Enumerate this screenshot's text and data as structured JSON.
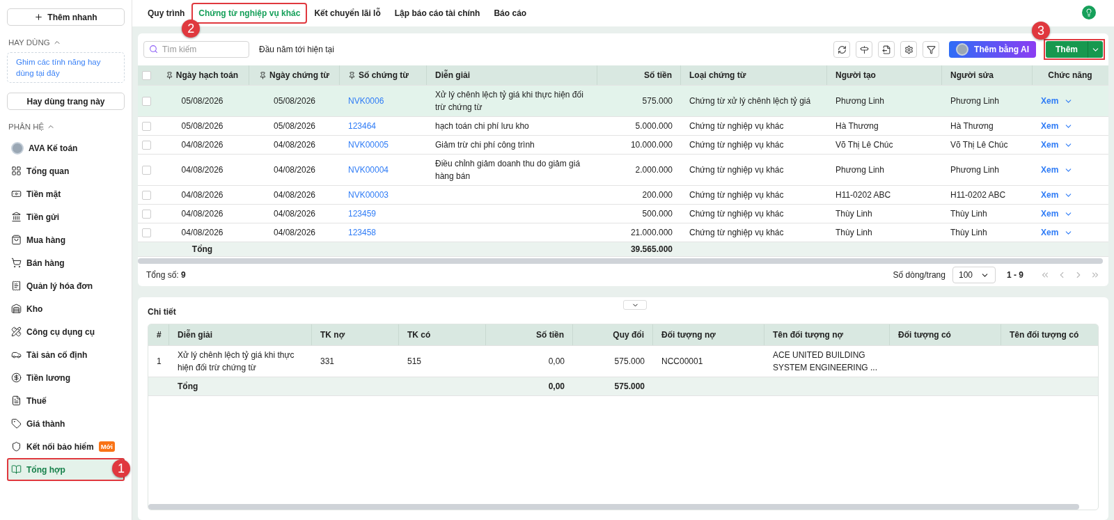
{
  "sidebar": {
    "quick_add": "Thêm nhanh",
    "favorites": {
      "title": "HAY DÙNG",
      "expanded": true,
      "hint": "Ghim các tính năng hay dùng tại đây",
      "button": "Hay dùng trang này"
    },
    "modules": {
      "title": "PHÂN HỆ",
      "expanded": true,
      "items": [
        {
          "label": "AVA Kế toán",
          "kind": "avatar",
          "selected": false
        },
        {
          "label": "Tổng quan",
          "kind": "module",
          "selected": false
        },
        {
          "label": "Tiền mặt",
          "kind": "module",
          "selected": false
        },
        {
          "label": "Tiền gửi",
          "kind": "module",
          "selected": false
        },
        {
          "label": "Mua hàng",
          "kind": "module",
          "selected": false
        },
        {
          "label": "Bán hàng",
          "kind": "module",
          "selected": false
        },
        {
          "label": "Quản lý hóa đơn",
          "kind": "module",
          "selected": false
        },
        {
          "label": "Kho",
          "kind": "module",
          "selected": false
        },
        {
          "label": "Công cụ dụng cụ",
          "kind": "module",
          "selected": false
        },
        {
          "label": "Tài sản cố định",
          "kind": "module",
          "selected": false
        },
        {
          "label": "Tiền lương",
          "kind": "module",
          "selected": false
        },
        {
          "label": "Thuế",
          "kind": "module",
          "selected": false
        },
        {
          "label": "Giá thành",
          "kind": "module",
          "selected": false
        },
        {
          "label": "Kết nối bảo hiểm",
          "kind": "module",
          "selected": false,
          "badge": "Mới"
        },
        {
          "label": "Tổng hợp",
          "kind": "module",
          "selected": true,
          "highlighted": true,
          "callout": "1"
        }
      ]
    }
  },
  "tabs": [
    {
      "label": "Quy trình",
      "selected": false
    },
    {
      "label": "Chứng từ nghiệp vụ khác",
      "selected": true,
      "highlighted": true,
      "callout": "2"
    },
    {
      "label": "Kết chuyển lãi lỗ",
      "selected": false
    },
    {
      "label": "Lập báo cáo tài chính",
      "selected": false
    },
    {
      "label": "Báo cáo",
      "selected": false
    }
  ],
  "toolbar": {
    "search": {
      "placeholder": "Tìm kiếm"
    },
    "period": "Đầu năm tới hiện tại",
    "ai_button": "Thêm bằng AI",
    "add_button": {
      "label": "Thêm",
      "highlighted": true,
      "callout": "3"
    }
  },
  "table": {
    "all_checked": false,
    "columns": [
      {
        "label": "Ngày hạch toán",
        "kind": "date",
        "pinned": true
      },
      {
        "label": "Ngày chứng từ",
        "kind": "date",
        "pinned": true
      },
      {
        "label": "Số chứng từ",
        "kind": "link",
        "pinned": true
      },
      {
        "label": "Diễn giải",
        "kind": "text",
        "pinned": false
      },
      {
        "label": "Số tiền",
        "kind": "amount",
        "pinned": false
      },
      {
        "label": "Loại chứng từ",
        "kind": "text",
        "pinned": false
      },
      {
        "label": "Người tạo",
        "kind": "text",
        "pinned": false
      },
      {
        "label": "Người sửa",
        "kind": "text",
        "pinned": false
      },
      {
        "label": "Chức năng",
        "kind": "action",
        "pinned": false
      }
    ],
    "rows": [
      {
        "selected": true,
        "checked": false,
        "cells": [
          "05/08/2026",
          "05/08/2026",
          "NVK0006",
          " Xử lý chênh lệch tỷ giá khi thực hiện đối trừ chứng từ",
          "575.000",
          "Chứng từ xử lý chênh lệch tỷ giá",
          "Phương Linh",
          "Phương Linh",
          "Xem"
        ]
      },
      {
        "selected": false,
        "checked": false,
        "cells": [
          "05/08/2026",
          "05/08/2026",
          "123464",
          "hạch toán chi phí lưu kho",
          "5.000.000",
          "Chứng từ nghiệp vụ khác",
          "Hà Thương",
          "Hà Thương",
          "Xem"
        ]
      },
      {
        "selected": false,
        "checked": false,
        "cells": [
          "04/08/2026",
          "04/08/2026",
          "NVK00005",
          "Giảm trừ chi phí công trình",
          "10.000.000",
          "Chứng từ nghiệp vụ khác",
          "Võ Thị Lê Chúc",
          "Võ Thị Lê Chúc",
          "Xem"
        ]
      },
      {
        "selected": false,
        "checked": false,
        "cells": [
          "04/08/2026",
          "04/08/2026",
          "NVK00004",
          "Điều chỉnh giảm doanh thu do giảm giá hàng bán",
          "2.000.000",
          "Chứng từ nghiệp vụ khác",
          "Phương Linh",
          "Phương Linh",
          "Xem"
        ]
      },
      {
        "selected": false,
        "checked": false,
        "cells": [
          "04/08/2026",
          "04/08/2026",
          "NVK00003",
          "",
          "200.000",
          "Chứng từ nghiệp vụ khác",
          "H11-0202 ABC",
          "H11-0202 ABC",
          "Xem"
        ]
      },
      {
        "selected": false,
        "checked": false,
        "cells": [
          "04/08/2026",
          "04/08/2026",
          "123459",
          "",
          "500.000",
          "Chứng từ nghiệp vụ khác",
          "Thùy Linh",
          "Thùy Linh",
          "Xem"
        ]
      },
      {
        "selected": false,
        "checked": false,
        "cells": [
          "04/08/2026",
          "04/08/2026",
          "123458",
          "",
          "21.000.000",
          "Chứng từ nghiệp vụ khác",
          "Thùy Linh",
          "Thùy Linh",
          "Xem"
        ]
      }
    ],
    "total": {
      "label": "Tổng",
      "amount": "39.565.000"
    }
  },
  "footer": {
    "count": "Tổng số: **9**",
    "page_size_label": "Số dòng/trang",
    "page_size": "100",
    "range": "1 - 9"
  },
  "detail": {
    "title": "Chi tiết",
    "columns": [
      {
        "label": "#",
        "kind": "text"
      },
      {
        "label": "Diễn giải",
        "kind": "text"
      },
      {
        "label": "TK nợ",
        "kind": "text"
      },
      {
        "label": "TK có",
        "kind": "text"
      },
      {
        "label": "Số tiền",
        "kind": "amount"
      },
      {
        "label": "Quy đổi",
        "kind": "amount"
      },
      {
        "label": "Đối tượng nợ",
        "kind": "text"
      },
      {
        "label": "Tên đối tượng nợ",
        "kind": "text"
      },
      {
        "label": "Đối tượng có",
        "kind": "text"
      },
      {
        "label": "Tên đối tượng có",
        "kind": "text"
      }
    ],
    "rows": [
      {
        "cells": [
          "1",
          " Xử lý chênh lệch tỷ giá khi thực hiện đối trừ chứng từ",
          "331",
          "515",
          "0,00",
          "575.000",
          "NCC00001",
          "ACE UNITED BUILDING SYSTEM ENGINEERING ...",
          "",
          ""
        ]
      }
    ],
    "total": {
      "label": "Tổng",
      "amount": "0,00",
      "converted": "575.000"
    }
  }
}
